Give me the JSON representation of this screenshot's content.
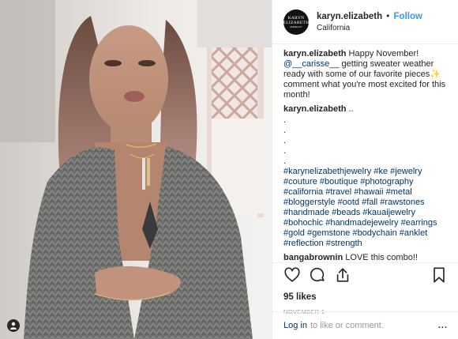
{
  "post": {
    "username": "karyn.elizabeth",
    "separator": "•",
    "follow_label": "Follow",
    "location": "California",
    "avatar_line1": "KARYN",
    "avatar_line2": "ELIZABETH",
    "avatar_line3": "JEWELRY"
  },
  "comments": [
    {
      "user": "karyn.elizabeth",
      "text_pre": "Happy November! ",
      "mention": "@__carisse__",
      "text_post": " getting sweater weather ready with some of our favorite pieces✨ comment what you're most excited for this month!"
    },
    {
      "user": "karyn.elizabeth",
      "text": "..",
      "dots": [
        ".",
        ".",
        ".",
        ".",
        "."
      ],
      "hashtags": "#karynelizabethjewelry #ke #jewelry #couture #boutique #photography #california #travel #hawaii #metal #bloggerstyle #ootd #fall #rawstones #handmade #beads #kauaijewelry #bohochic #handmadejewelry #earrings #gold #gemstone #bodychain #anklet #reflection #strength"
    },
    {
      "user": "bangabrownin",
      "text": "LOVE this combo!!"
    }
  ],
  "actions": {
    "like_icon": "heart-icon",
    "comment_icon": "comment-icon",
    "share_icon": "share-icon",
    "save_icon": "bookmark-icon",
    "likes": "95 likes",
    "date": "NOVEMBER 1"
  },
  "footer": {
    "login_link": "Log in",
    "login_text": "to like or comment.",
    "more": "..."
  },
  "colors": {
    "follow": "#3897f0",
    "link": "#003569",
    "muted": "#999999",
    "text": "#262626"
  }
}
